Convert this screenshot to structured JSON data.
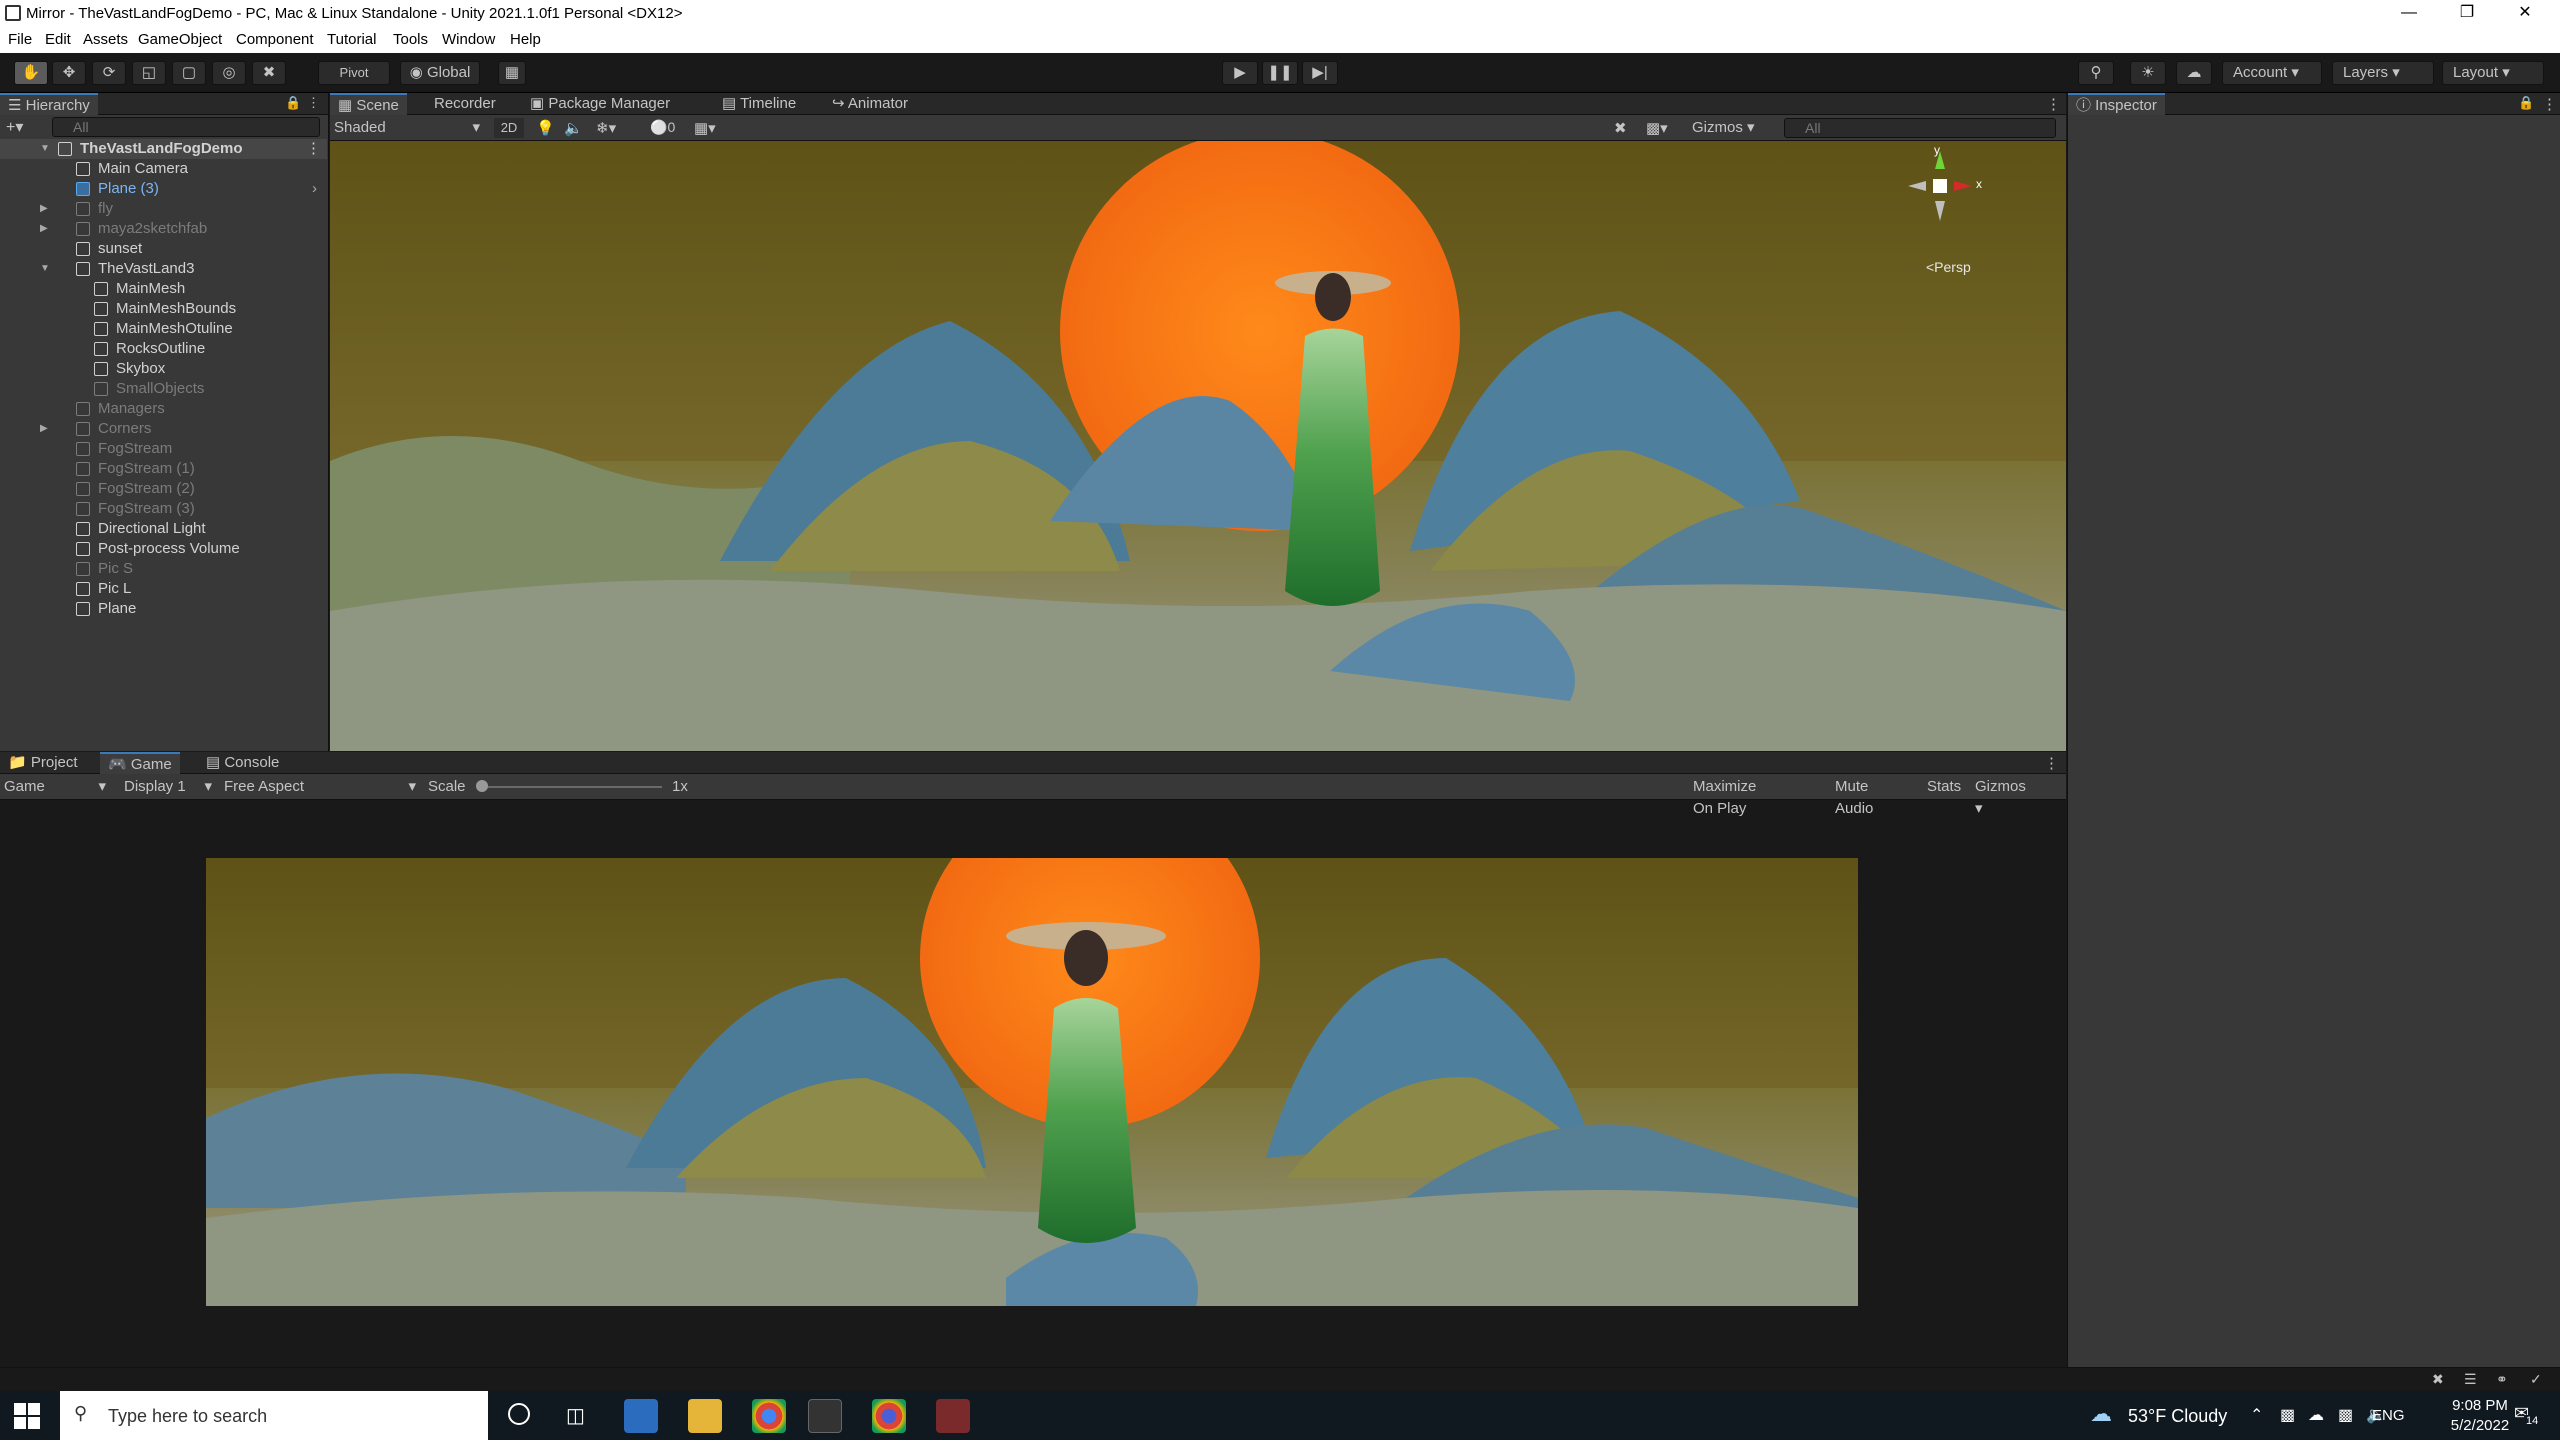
{
  "window": {
    "title": "Mirror - TheVastLandFogDemo - PC, Mac & Linux Standalone - Unity 2021.1.0f1 Personal <DX12>"
  },
  "menu": [
    "File",
    "Edit",
    "Assets",
    "GameObject",
    "Component",
    "Tutorial",
    "Tools",
    "Window",
    "Help"
  ],
  "toolbar": {
    "pivot_label": "Pivot",
    "global_label": "Global",
    "account_label": "Account",
    "layers_label": "Layers",
    "layout_label": "Layout"
  },
  "hierarchy": {
    "tab_label": "Hierarchy",
    "search_placeholder": "All",
    "root": "TheVastLandFogDemo",
    "items": [
      {
        "label": "Main Camera",
        "state": "normal"
      },
      {
        "label": "Plane (3)",
        "state": "selected"
      },
      {
        "label": "fly",
        "state": "dim"
      },
      {
        "label": "maya2sketchfab",
        "state": "dim"
      },
      {
        "label": "sunset",
        "state": "normal"
      },
      {
        "label": "TheVastLand3",
        "state": "normal"
      },
      {
        "label": "MainMesh",
        "state": "normal"
      },
      {
        "label": "MainMeshBounds",
        "state": "normal"
      },
      {
        "label": "MainMeshOtuline",
        "state": "normal"
      },
      {
        "label": "RocksOutline",
        "state": "normal"
      },
      {
        "label": "Skybox",
        "state": "normal"
      },
      {
        "label": "SmallObjects",
        "state": "dim"
      },
      {
        "label": "Managers",
        "state": "dim"
      },
      {
        "label": "Corners",
        "state": "dim"
      },
      {
        "label": "FogStream",
        "state": "dim"
      },
      {
        "label": "FogStream (1)",
        "state": "dim"
      },
      {
        "label": "FogStream (2)",
        "state": "dim"
      },
      {
        "label": "FogStream (3)",
        "state": "dim"
      },
      {
        "label": "Directional Light",
        "state": "normal"
      },
      {
        "label": "Post-process Volume",
        "state": "normal"
      },
      {
        "label": "Pic S",
        "state": "dim"
      },
      {
        "label": "Pic L",
        "state": "normal"
      },
      {
        "label": "Plane",
        "state": "normal"
      }
    ]
  },
  "scene": {
    "tabs": [
      "Scene",
      "Recorder",
      "Package Manager",
      "Timeline",
      "Animator"
    ],
    "shading_mode": "Shaded",
    "two_d_label": "2D",
    "hidden_count": "0",
    "gizmos_label": "Gizmos",
    "search_placeholder": "All",
    "gizmo_y": "y",
    "gizmo_x": "x",
    "persp_label": "<Persp"
  },
  "bottom": {
    "tabs": [
      "Project",
      "Game",
      "Console"
    ],
    "game_mode": "Game",
    "display": "Display 1",
    "aspect": "Free Aspect",
    "scale_label": "Scale",
    "scale_value": "1x",
    "options": [
      "Maximize On Play",
      "Mute Audio",
      "Stats",
      "Gizmos"
    ]
  },
  "inspector": {
    "tab_label": "Inspector"
  },
  "taskbar": {
    "search_placeholder": "Type here to search",
    "weather": "53°F  Cloudy",
    "lang": "ENG",
    "time": "9:08 PM",
    "date": "5/2/2022",
    "notif_count": "14"
  }
}
